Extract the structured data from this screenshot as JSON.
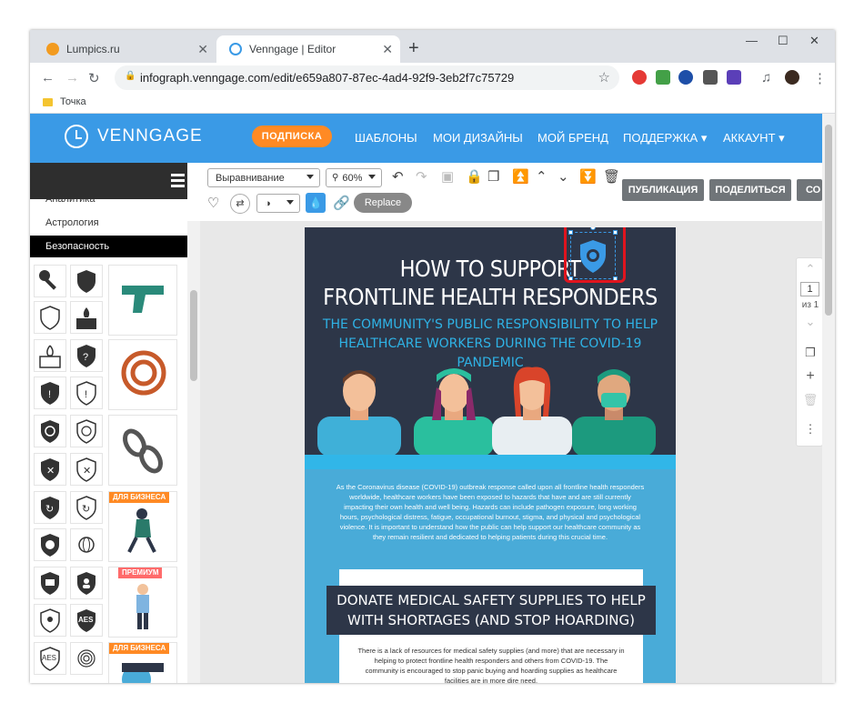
{
  "browser": {
    "tabs": [
      {
        "title": "Lumpics.ru",
        "fav_color": "#f29b20"
      },
      {
        "title": "Venngage | Editor",
        "fav_color": "#3a9ae6"
      }
    ],
    "url": "infograph.venngage.com/edit/e659a807-87ec-4ad4-92f9-3eb2f7c75729",
    "bookmark": "Точка"
  },
  "venngage": {
    "logo": "VENNGAGE",
    "subscribe": "ПОДПИСКА",
    "nav": [
      "ШАБЛОНЫ",
      "МОИ ДИЗАЙНЫ",
      "МОЙ БРЕНД",
      "ПОДДЕРЖКА ▾",
      "АККАУНТ ▾"
    ]
  },
  "toolbar": {
    "align": "Выравнивание",
    "zoom": "60%",
    "replace": "Replace",
    "publish": "ПУБЛИКАЦИЯ",
    "share": "ПОДЕЛИТЬСЯ",
    "more": "СО"
  },
  "sidebar": {
    "categories": [
      "Аналитика",
      "Астрология",
      "Безопасность"
    ],
    "badges": {
      "business": "ДЛЯ БИЗНЕСА",
      "premium": "ПРЕМИУМ"
    },
    "aes1": "AES",
    "aes2": "AES"
  },
  "poster": {
    "title1": "HOW TO SUPPORT",
    "title2": "FRONTLINE HEALTH RESPONDERS",
    "sub1": "THE COMMUNITY'S PUBLIC RESPONSIBILITY TO HELP",
    "sub2": "HEALTHCARE WORKERS DURING THE COVID-19 PANDEMIC",
    "body": "As the Coronavirus disease (COVID-19) outbreak response called upon all frontline health responders worldwide, healthcare workers have been exposed to hazards that have and are still currently impacting their own health and well being. Hazards can include pathogen exposure, long working hours, psychological distress, fatigue, occupational burnout, stigma, and physical and psychological violence. It is important to understand how the public can help support our healthcare community as they remain resilient and dedicated to helping patients during this crucial time.",
    "banner1": "DONATE MEDICAL SAFETY SUPPLIES TO HELP",
    "banner2": "WITH SHORTAGES (AND STOP HOARDING)",
    "card": "There is a lack of resources for medical safety supplies (and more) that are necessary in helping to protect frontline health responders and others from COVID-19. The community is encouraged to stop panic buying and hoarding supplies as healthcare facilities are in more dire need."
  },
  "pager": {
    "page": "1",
    "of": "из 1"
  },
  "colors": {
    "brand": "#3a9ae6",
    "accent": "#ff8a24",
    "poster_bg": "#2d3648",
    "highlight": "#e0141e"
  }
}
